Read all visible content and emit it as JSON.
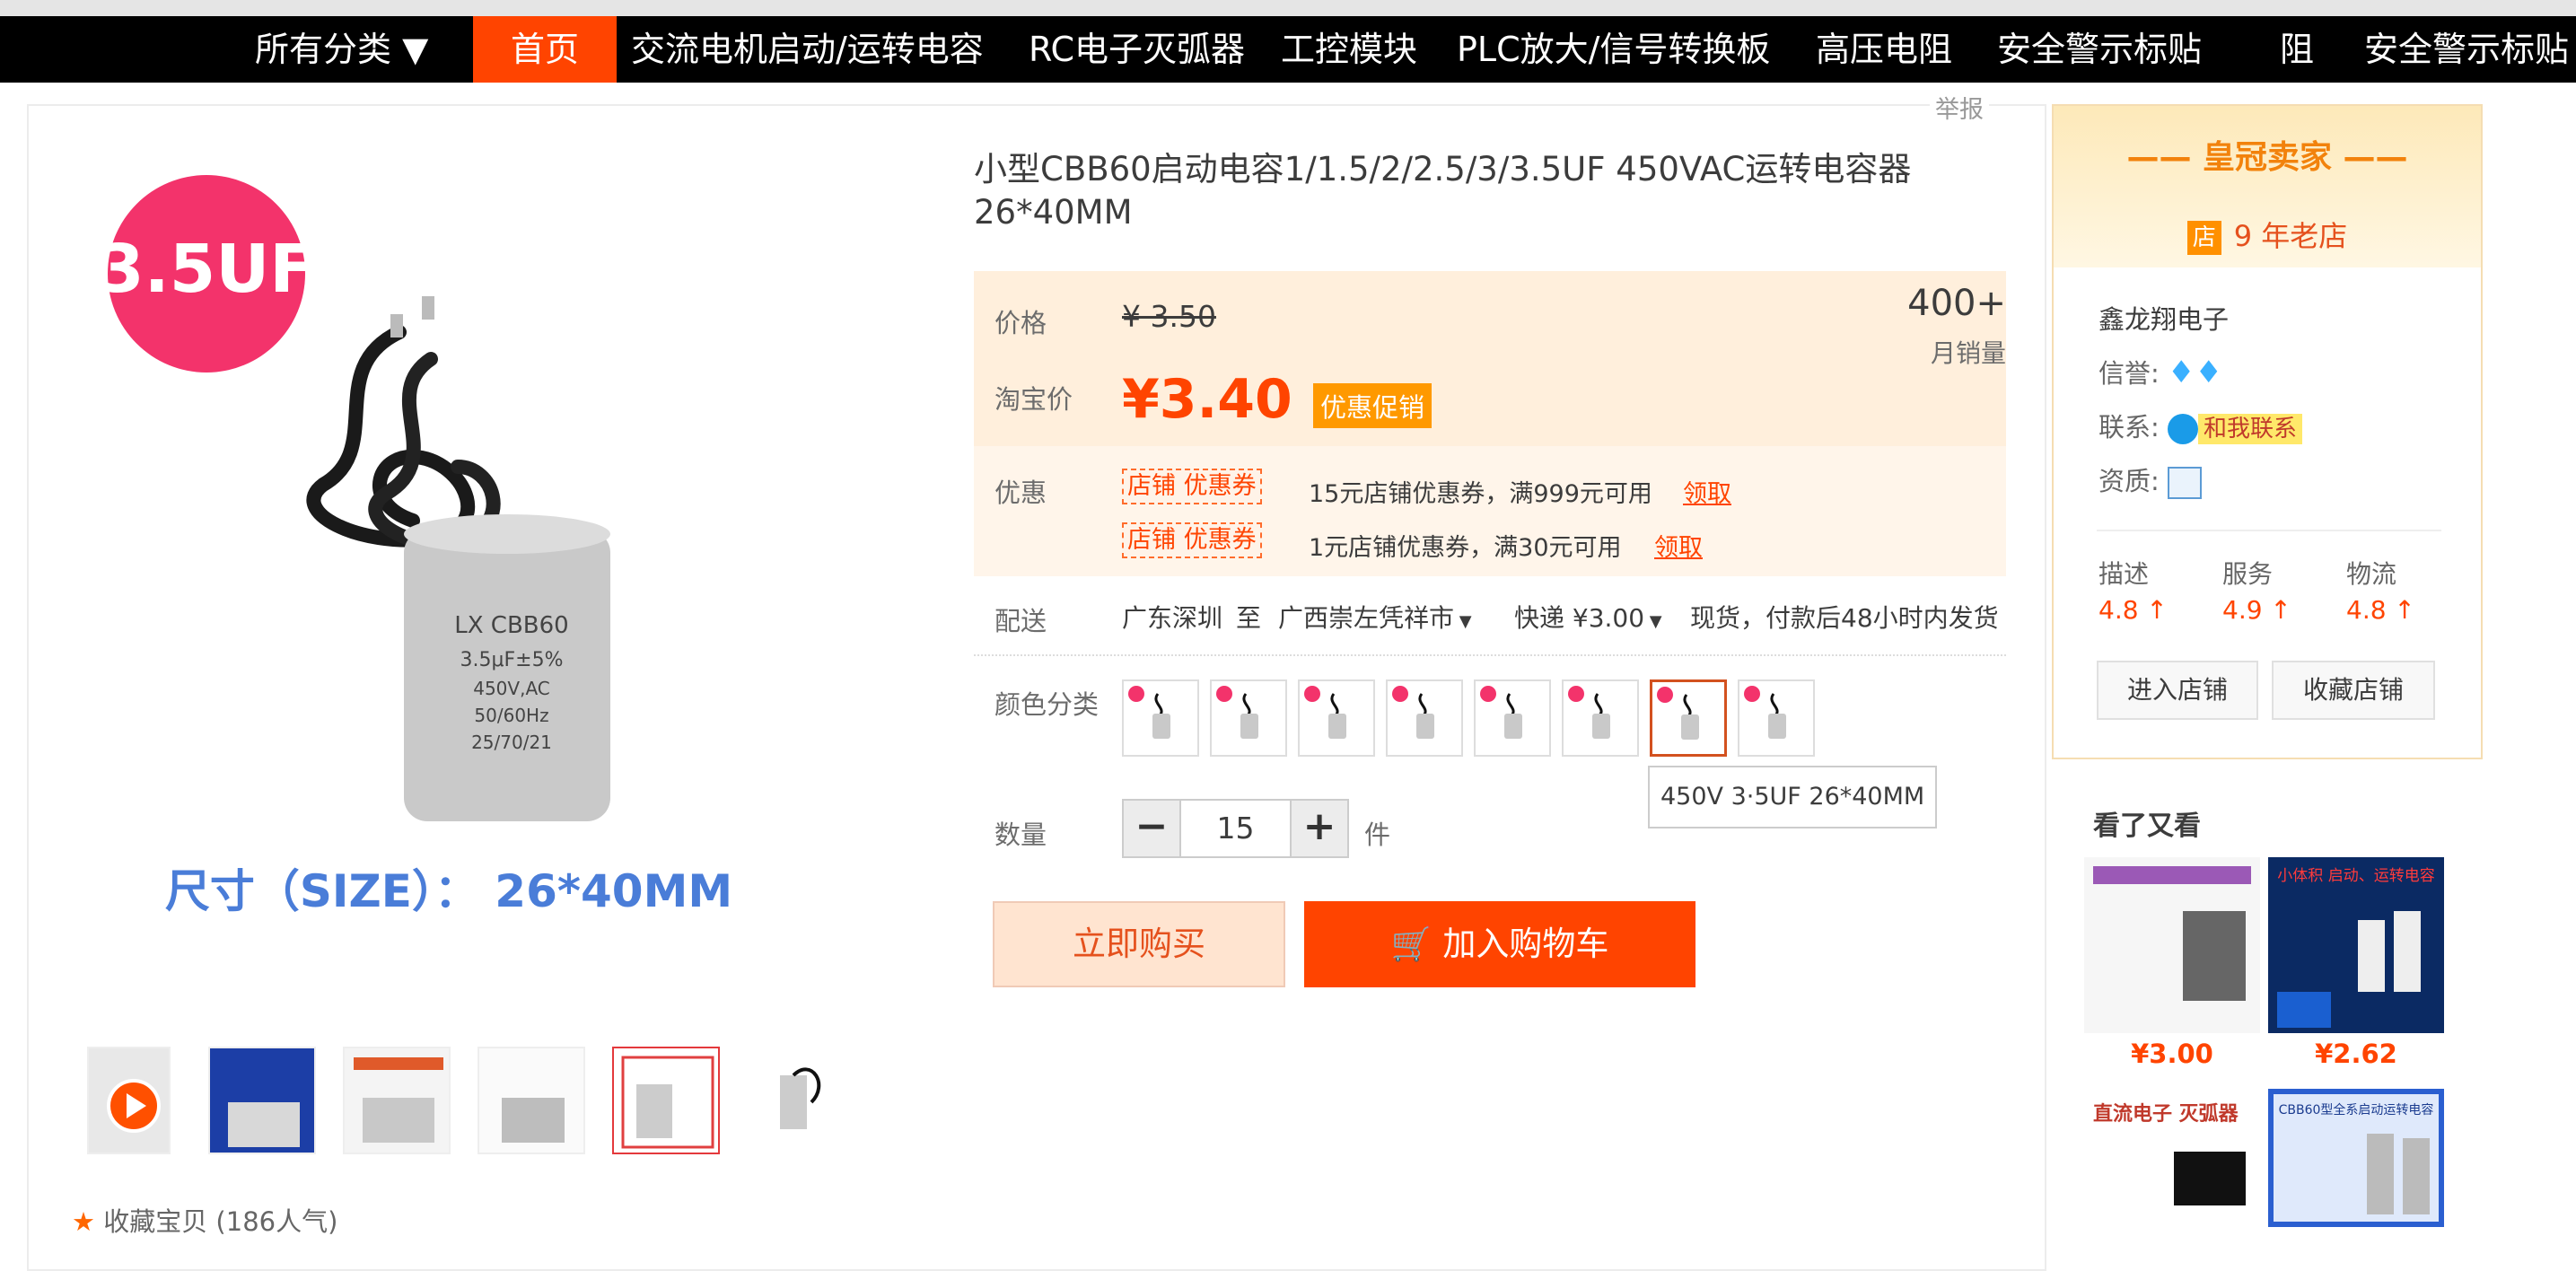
{
  "nav": {
    "all_categories": "所有分类 ▼",
    "items": [
      "首页",
      "交流电机启动/运转电容",
      "RC电子灭弧器",
      "工控模块",
      "PLC放大/信号转换板",
      "高压电阻",
      "安全警示标贴",
      "阻",
      "安全警示标贴"
    ]
  },
  "report": "举报",
  "main_image": {
    "badge": "3.5UF",
    "capacitor_lines": [
      "LX CBB60",
      "3.5μF±5%",
      "450V,AC",
      "50/60Hz",
      "25/70/21"
    ],
    "caption": "尺寸（SIZE）： 26*40MM"
  },
  "thumbnails": 6,
  "favorite": "收藏宝贝 (186人气)",
  "product": {
    "title": "小型CBB60启动电容1/1.5/2/2.5/3/3.5UF 450VAC运转电容器26*40MM",
    "price_label": "价格",
    "original_price": "¥ 3.50",
    "taobao_label": "淘宝价",
    "price": "¥3.40",
    "promo_tag": "优惠促销",
    "sales_count": "400+",
    "sales_label": "月销量",
    "discount_label": "优惠",
    "coupons": [
      {
        "tag": "店铺 优惠券",
        "text": "15元店铺优惠券，满999元可用",
        "link": "领取"
      },
      {
        "tag": "店铺 优惠券",
        "text": "1元店铺优惠券，满30元可用",
        "link": "领取"
      }
    ],
    "delivery_label": "配送",
    "from": "广东深圳",
    "to_word": "至",
    "destination": "广西崇左凭祥市",
    "express": "快递 ¥3.00",
    "ship_note": "现货，付款后48小时内发货",
    "color_label": "颜色分类",
    "swatch_count": 8,
    "selected_swatch": 7,
    "tooltip": "450V 3·5UF 26*40MM",
    "qty_label": "数量",
    "qty_minus": "−",
    "quantity": "15",
    "qty_plus": "+",
    "qty_unit": "件",
    "buy_now": "立即购买",
    "add_cart": "加入购物车"
  },
  "seller": {
    "crown": "—— 皇冠卖家 ——",
    "store_icon": "店",
    "years": "9 年老店",
    "name": "鑫龙翔电子",
    "credit_label": "信誉:",
    "contact_label": "联系:",
    "contact_btn": "和我联系",
    "qual_label": "资质:",
    "ratings": [
      {
        "label": "描述",
        "value": "4.8 ↑"
      },
      {
        "label": "服务",
        "value": "4.9 ↑"
      },
      {
        "label": "物流",
        "value": "4.8 ↑"
      }
    ],
    "enter_store": "进入店铺",
    "fav_store": "收藏店铺"
  },
  "recommend": {
    "title": "看了又看",
    "prices": [
      "¥3.00",
      "¥2.62"
    ],
    "img_texts": [
      "小体积 启动、运转电容",
      "直流电子 灭弧器",
      "CBB60型全系启动运转电容"
    ]
  },
  "colors": {
    "accent": "#ff4400",
    "nav_bg": "#000000",
    "price_bg": "#ffefdc",
    "promo": "#ff9900",
    "crown": "#f2820c"
  }
}
